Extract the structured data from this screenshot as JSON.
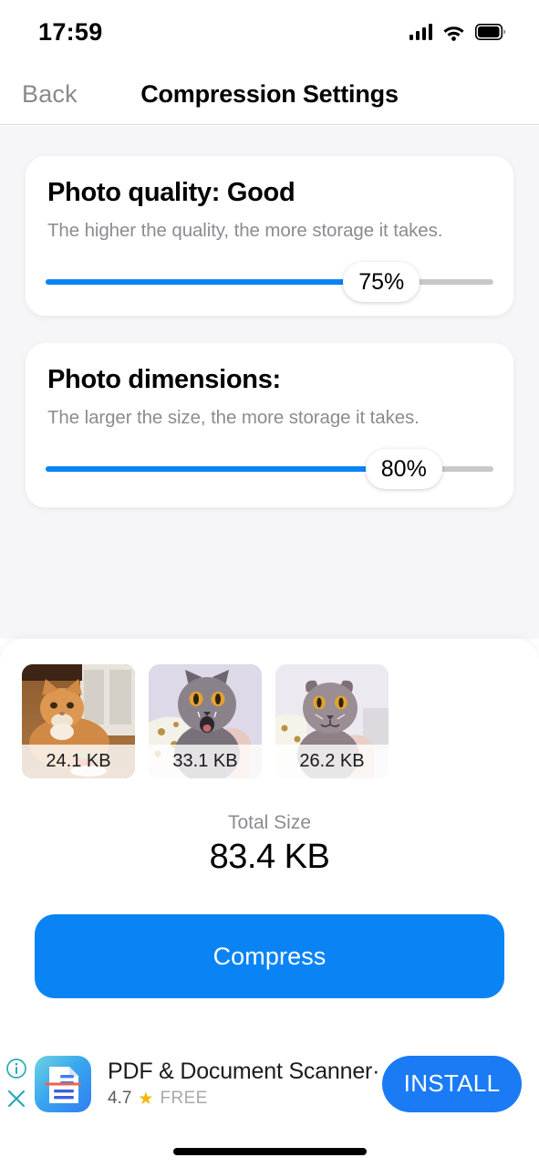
{
  "status_bar": {
    "time": "17:59",
    "signal_icon": "cellular-signal-icon",
    "wifi_icon": "wifi-icon",
    "battery_icon": "battery-icon"
  },
  "nav": {
    "back_label": "Back",
    "title": "Compression Settings"
  },
  "settings": {
    "quality": {
      "title": "Photo quality: Good",
      "subtitle": "The higher the quality, the more storage it takes.",
      "value_label": "75%",
      "value": 75
    },
    "dimensions": {
      "title": "Photo dimensions:",
      "subtitle": "The larger the size, the more storage it takes.",
      "value_label": "80%",
      "value": 80
    }
  },
  "preview": {
    "thumbnails": [
      {
        "size_label": "24.1 KB",
        "alt": "orange-tabby-cat-with-watermelon"
      },
      {
        "size_label": "33.1 KB",
        "alt": "gray-british-shorthair-cat-mouth-open"
      },
      {
        "size_label": "26.2 KB",
        "alt": "gray-scottish-fold-cat"
      }
    ],
    "total_label": "Total Size",
    "total_value": "83.4 KB",
    "compress_label": "Compress"
  },
  "ad": {
    "info_icon": "info-circle-icon",
    "close_icon": "close-icon",
    "app_icon": "pdf-document-scanner-app-icon",
    "title": "PDF & Document Scanner·",
    "rating": "4.7",
    "star_icon": "star-icon",
    "price": "FREE",
    "install_label": "INSTALL"
  },
  "colors": {
    "accent_blue": "#0a84f5",
    "install_blue": "#1a7bf5",
    "track_gray": "#c9c9cb",
    "page_bg": "#f6f6f8",
    "muted_text": "#8c8c90",
    "ad_teal": "#2aa9b5",
    "star_gold": "#f7b500"
  },
  "home_indicator": "home-indicator"
}
